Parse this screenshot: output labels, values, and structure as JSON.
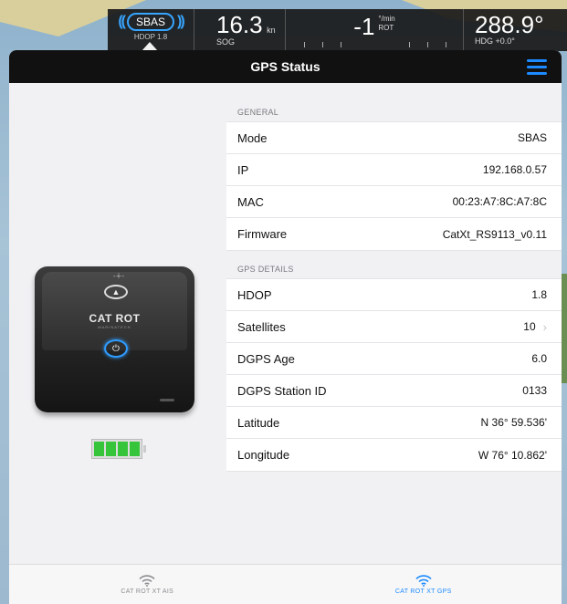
{
  "instruments": {
    "sbas": {
      "label": "SBAS",
      "sub": "HDOP 1.8"
    },
    "sog": {
      "value": "16.3",
      "unit": "kn",
      "label": "SOG"
    },
    "rot": {
      "value": "-1",
      "unit_top": "°/min",
      "unit_bottom": "ROT"
    },
    "hdg": {
      "value": "288.9°",
      "label": "HDG +0.0°"
    }
  },
  "modal": {
    "title": "GPS Status",
    "menu_icon": "hamburger-menu-icon",
    "accent_color": "#1d8bff"
  },
  "device": {
    "brand": "CAT ROT",
    "brand_sub": "MARINATECH",
    "battery_cells": 4
  },
  "general": {
    "header": "GENERAL",
    "rows": [
      {
        "label": "Mode",
        "value": "SBAS"
      },
      {
        "label": "IP",
        "value": "192.168.0.57"
      },
      {
        "label": "MAC",
        "value": "00:23:A7:8C:A7:8C"
      },
      {
        "label": "Firmware",
        "value": "CatXt_RS9113_v0.11"
      }
    ]
  },
  "gps_details": {
    "header": "GPS DETAILS",
    "rows": [
      {
        "label": "HDOP",
        "value": "1.8"
      },
      {
        "label": "Satellites",
        "value": "10"
      },
      {
        "label": "DGPS Age",
        "value": "6.0"
      },
      {
        "label": "DGPS Station ID",
        "value": "0133"
      },
      {
        "label": "Latitude",
        "value": "N 36° 59.536'"
      },
      {
        "label": "Longitude",
        "value": "W 76° 10.862'"
      }
    ]
  },
  "tabs": [
    {
      "label": "CAT ROT XT AIS",
      "icon": "wifi-icon",
      "active": false
    },
    {
      "label": "CAT ROT XT GPS",
      "icon": "wifi-icon",
      "active": true
    }
  ]
}
